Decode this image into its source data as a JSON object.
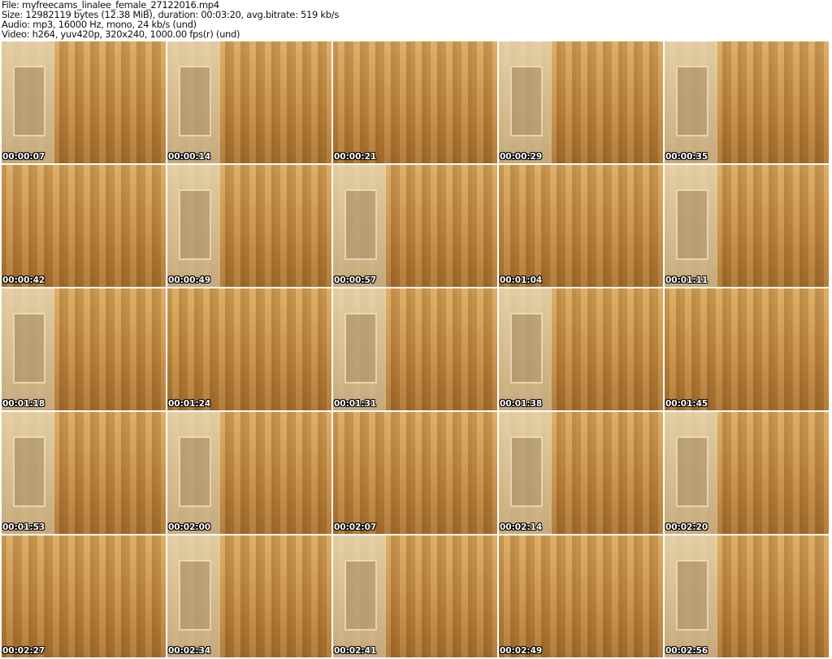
{
  "header": {
    "file": "File: myfreecams_linalee_female_27122016.mp4",
    "size": "Size: 12982119 bytes (12.38 MiB), duration: 00:03:20, avg.bitrate: 519 kb/s",
    "audio": "Audio: mp3, 16000 Hz, mono, 24 kb/s (und)",
    "video": "Video: h264, yuv420p, 320x240, 1000.00 fps(r) (und)"
  },
  "thumbnails": [
    "00:00:07",
    "00:00:14",
    "00:00:21",
    "00:00:29",
    "00:00:35",
    "00:00:42",
    "00:00:49",
    "00:00:57",
    "00:01:04",
    "00:01:11",
    "00:01:18",
    "00:01:24",
    "00:01:31",
    "00:01:38",
    "00:01:45",
    "00:01:53",
    "00:02:00",
    "00:02:07",
    "00:02:14",
    "00:02:20",
    "00:02:27",
    "00:02:34",
    "00:02:41",
    "00:02:49",
    "00:02:56"
  ]
}
